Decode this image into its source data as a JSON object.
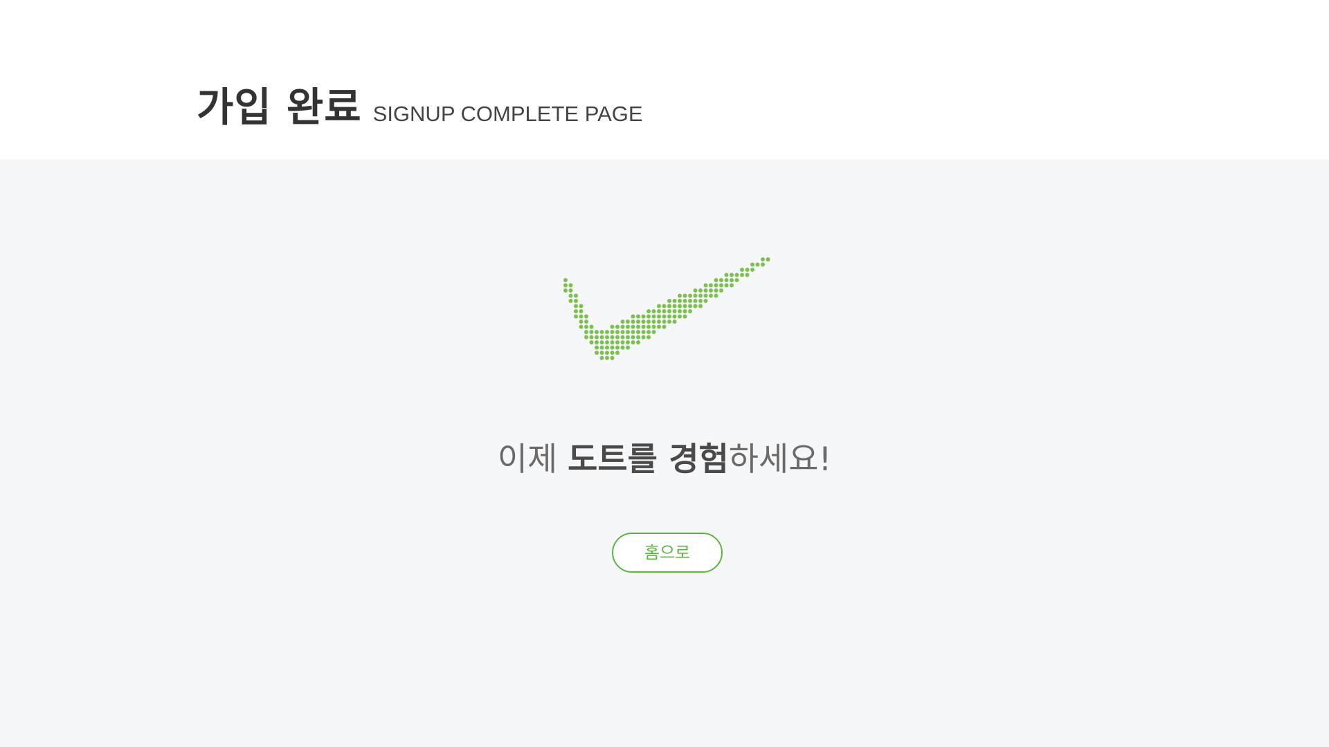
{
  "header": {
    "title": "가입 완료",
    "subtitle": "SIGNUP COMPLETE PAGE"
  },
  "main": {
    "icon": "dotted-checkmark-icon",
    "message_parts": {
      "prefix": "이제 ",
      "emphasis": "도트를 경험",
      "suffix": "하세요!"
    },
    "home_button_label": "홈으로"
  },
  "colors": {
    "accent": "#5cb540",
    "check_dots": "#7cc04f",
    "content_bg": "#f6f7f9",
    "header_bg": "#ffffff",
    "title": "#333333",
    "message": "#6b6b6b"
  }
}
